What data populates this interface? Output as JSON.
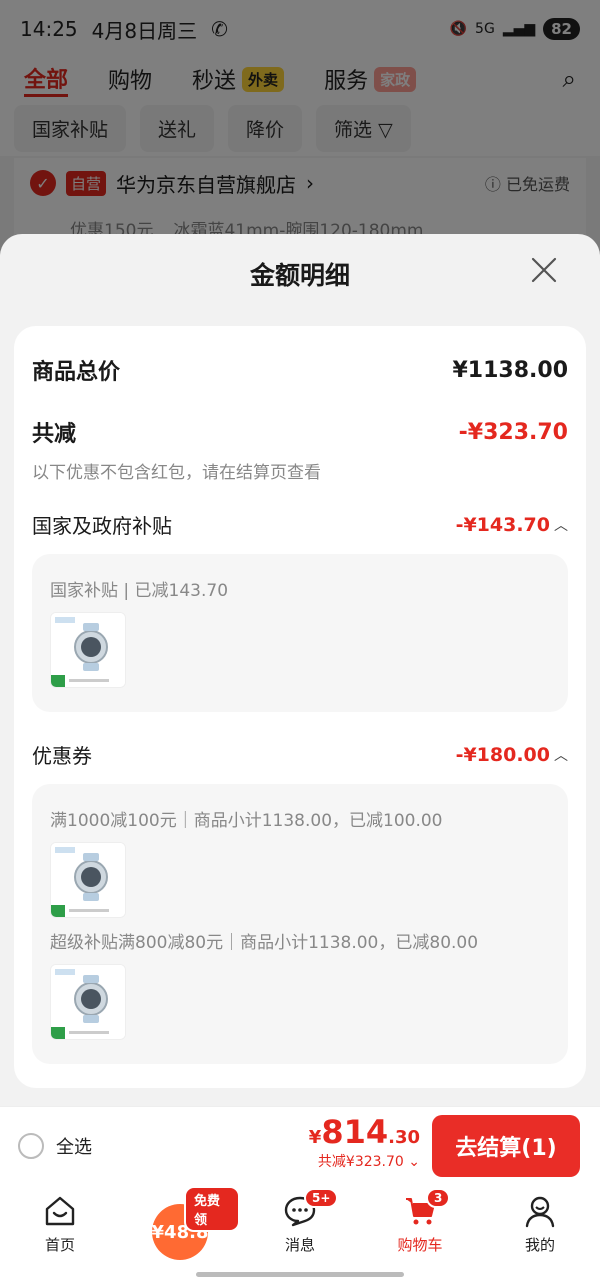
{
  "status_bar": {
    "time": "14:25",
    "date": "4月8日周三",
    "network": "5G",
    "battery": "82"
  },
  "top_nav": {
    "tabs": [
      {
        "label": "全部",
        "active": true
      },
      {
        "label": "购物"
      },
      {
        "label": "秒送",
        "tag": "外卖"
      },
      {
        "label": "服务",
        "tag": "家政"
      }
    ]
  },
  "filters": [
    "国家补贴",
    "送礼",
    "降价",
    "筛选"
  ],
  "store": {
    "tag": "自营",
    "name": "华为京东自营旗舰店",
    "shipping": "已免运费"
  },
  "item_peek": {
    "promo": "优惠150元",
    "variant": "冰霜蓝41mm-腕围120-180mm"
  },
  "sheet": {
    "title": "金额明细",
    "total_label": "商品总价",
    "total_value": "¥1138.00",
    "discount_label": "共减",
    "discount_value": "-¥323.70",
    "discount_note": "以下优惠不包含红包，请在结算页查看",
    "sections": [
      {
        "label": "国家及政府补贴",
        "value": "-¥143.70",
        "details": [
          {
            "text": "国家补贴 | 已减143.70"
          }
        ]
      },
      {
        "label": "优惠券",
        "value": "-¥180.00",
        "details": [
          {
            "text": "满1000减100元｜商品小计1138.00，已减100.00"
          },
          {
            "text": "超级补贴满800减80元｜商品小计1138.00，已减80.00"
          }
        ]
      }
    ]
  },
  "checkout": {
    "select_all": "全选",
    "currency": "¥",
    "price_int": "814",
    "price_dec": ".30",
    "saved": "共减¥323.70",
    "button": "去结算(1)"
  },
  "tabbar": [
    {
      "label": "首页"
    },
    {
      "label": "¥48.8",
      "badge": "免费领"
    },
    {
      "label": "消息",
      "badge": "5+"
    },
    {
      "label": "购物车",
      "badge": "3",
      "active": true
    },
    {
      "label": "我的"
    }
  ],
  "colors": {
    "accent": "#e4281f",
    "button": "#e92d27"
  }
}
